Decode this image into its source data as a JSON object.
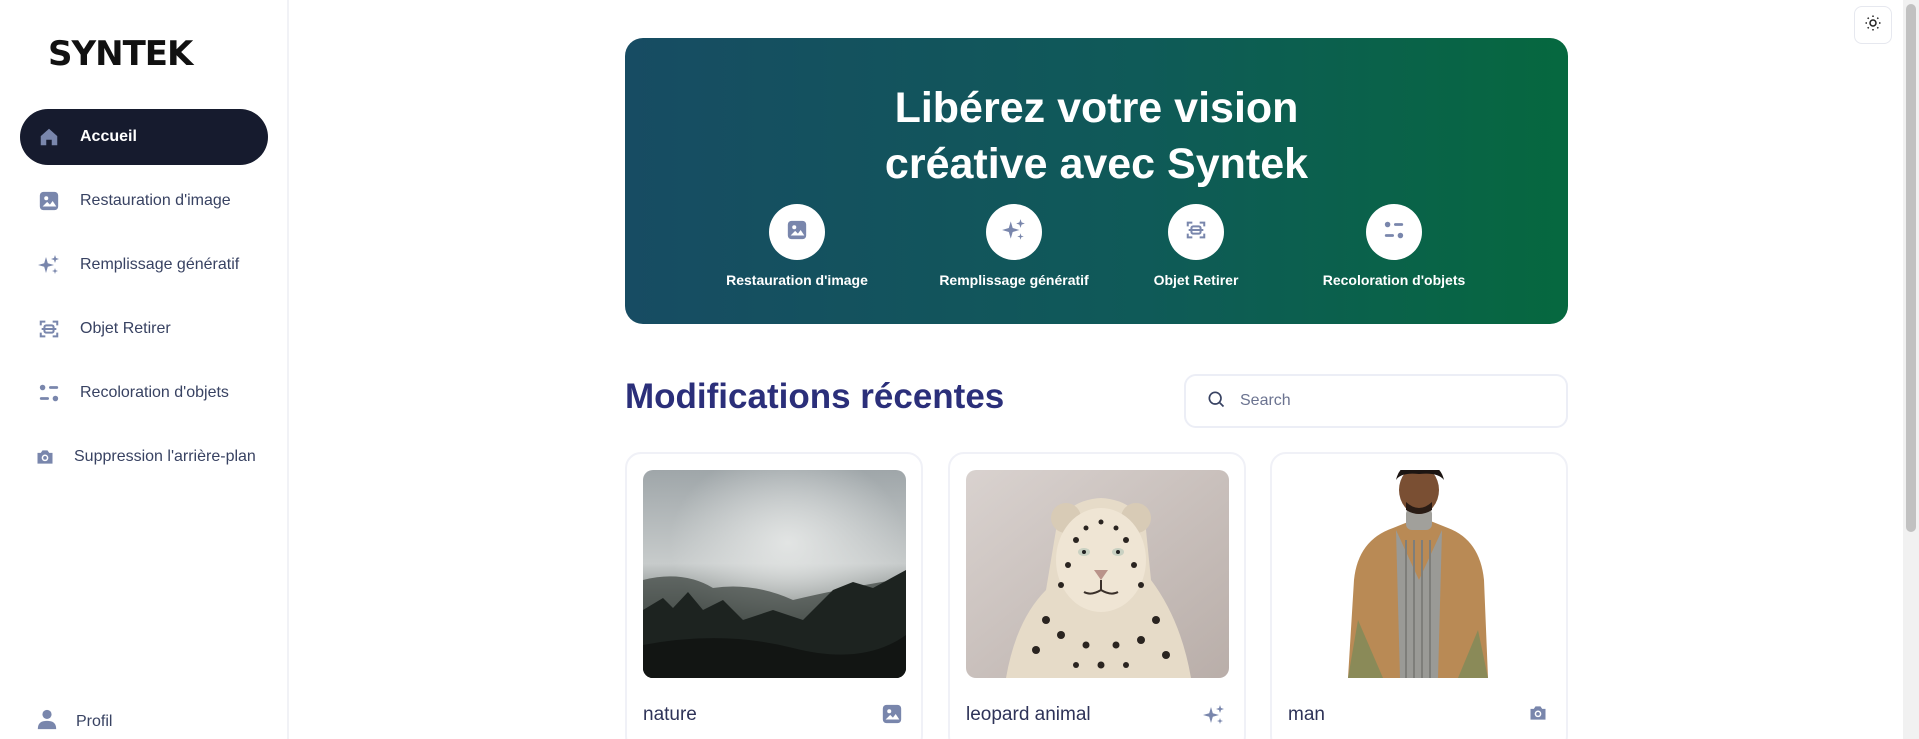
{
  "app": {
    "logo_text": "SYNTEK"
  },
  "sidebar": {
    "items": [
      {
        "label": "Accueil",
        "icon": "home-icon",
        "active": true
      },
      {
        "label": "Restauration d'image",
        "icon": "image-icon"
      },
      {
        "label": "Remplissage génératif",
        "icon": "sparkles-icon"
      },
      {
        "label": "Objet Retirer",
        "icon": "scan-icon"
      },
      {
        "label": "Recoloration d'objets",
        "icon": "filter-icon"
      },
      {
        "label": "Suppression l'arrière-plan",
        "icon": "camera-icon"
      }
    ],
    "profile_label": "Profil"
  },
  "hero": {
    "title_line1": "Libérez votre vision",
    "title_line2": "créative avec Syntek",
    "actions": [
      {
        "label": "Restauration d'image",
        "icon": "image-icon"
      },
      {
        "label": "Remplissage génératif",
        "icon": "sparkles-icon"
      },
      {
        "label": "Objet Retirer",
        "icon": "scan-icon"
      },
      {
        "label": "Recoloration d'objets",
        "icon": "filter-icon"
      }
    ]
  },
  "recent": {
    "title": "Modifications récentes",
    "search_placeholder": "Search",
    "cards": [
      {
        "name": "nature",
        "icon": "image-icon"
      },
      {
        "name": "leopard animal",
        "icon": "sparkles-icon"
      },
      {
        "name": "man",
        "icon": "camera-icon"
      }
    ]
  },
  "colors": {
    "sidebar_active_bg": "#161b2e",
    "icon": "#7986ac",
    "hero_gradient_start": "#174c63",
    "hero_gradient_end": "#06683f",
    "heading": "#2b2f7a"
  }
}
